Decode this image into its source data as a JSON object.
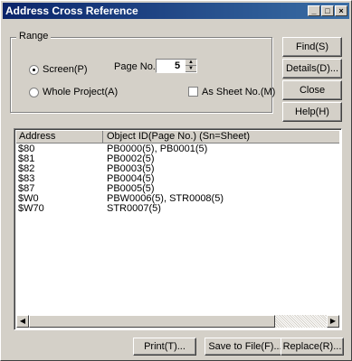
{
  "window": {
    "title": "Address Cross Reference"
  },
  "range": {
    "group_label": "Range",
    "screen_label": "Screen(P)",
    "whole_project_label": "Whole Project(A)",
    "page_no_label": "Page No.",
    "page_no_value": "5",
    "as_sheet_label": "As Sheet No.(M)"
  },
  "side_buttons": {
    "find": "Find(S)",
    "details": "Details(D)...",
    "close": "Close",
    "help": "Help(H)"
  },
  "table": {
    "headers": [
      "Address",
      "Object ID(Page No.) (Sn=Sheet)"
    ],
    "rows": [
      [
        "$80",
        "PB0000(5), PB0001(5)"
      ],
      [
        "$81",
        "PB0002(5)"
      ],
      [
        "$82",
        "PB0003(5)"
      ],
      [
        "$83",
        "PB0004(5)"
      ],
      [
        "$87",
        "PB0005(5)"
      ],
      [
        "$W0",
        "PBW0006(5), STR0008(5)"
      ],
      [
        "$W70",
        "STR0007(5)"
      ]
    ]
  },
  "bottom_buttons": {
    "print": "Print(T)...",
    "save": "Save to File(F)...",
    "replace": "Replace(R)..."
  }
}
